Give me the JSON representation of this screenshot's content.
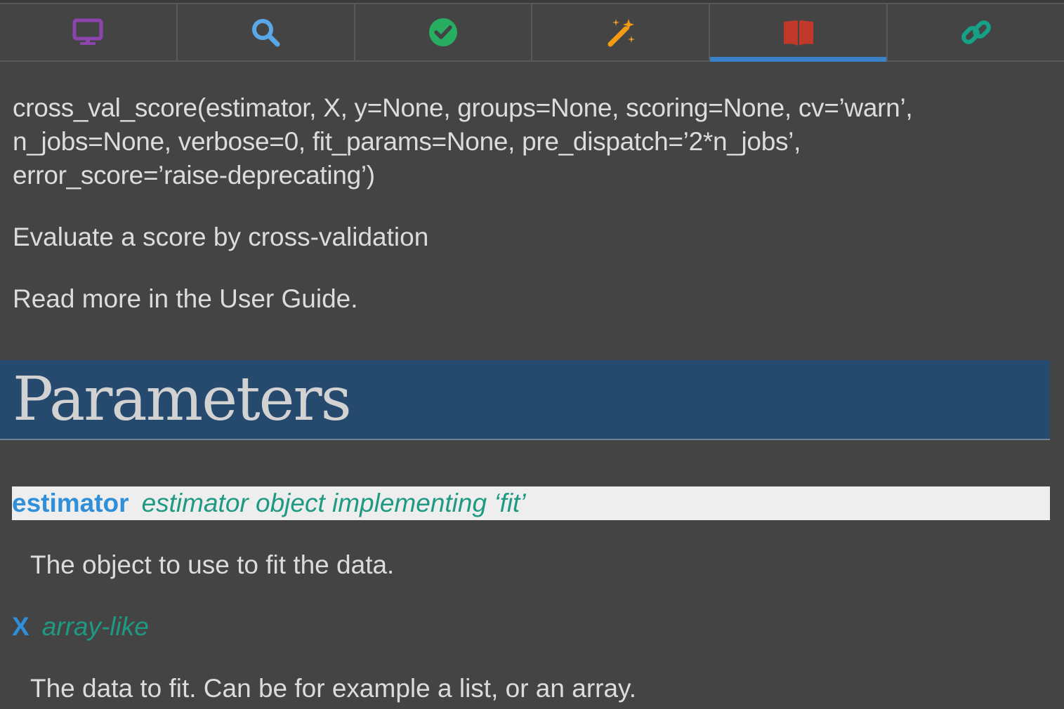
{
  "tabs": [
    {
      "icon": "monitor-icon",
      "color": "#8e44ad",
      "active": false
    },
    {
      "icon": "search-icon",
      "color": "#5aa7e8",
      "active": false
    },
    {
      "icon": "check-circle-icon",
      "color": "#27ae60",
      "active": false
    },
    {
      "icon": "magic-wand-icon",
      "color": "#f39c12",
      "active": false
    },
    {
      "icon": "book-icon",
      "color": "#c0392b",
      "active": true
    },
    {
      "icon": "link-icon",
      "color": "#16a085",
      "active": false
    }
  ],
  "doc": {
    "signature_lines": [
      "cross_val_score(estimator, X, y=None, groups=None, scoring=None, cv=’warn’,",
      "n_jobs=None, verbose=0, fit_params=None, pre_dispatch=’2*n_jobs’,",
      "error_score=’raise-deprecating’)"
    ],
    "summary": "Evaluate a score by cross-validation",
    "guide": "Read more in the User Guide.",
    "section_title": "Parameters",
    "params": [
      {
        "name": "estimator",
        "type": "estimator object implementing ‘fit’",
        "desc": "The object to use to fit the data."
      },
      {
        "name": "X",
        "type": "array-like",
        "desc": "The data to fit. Can be for example a list, or an array."
      }
    ]
  }
}
